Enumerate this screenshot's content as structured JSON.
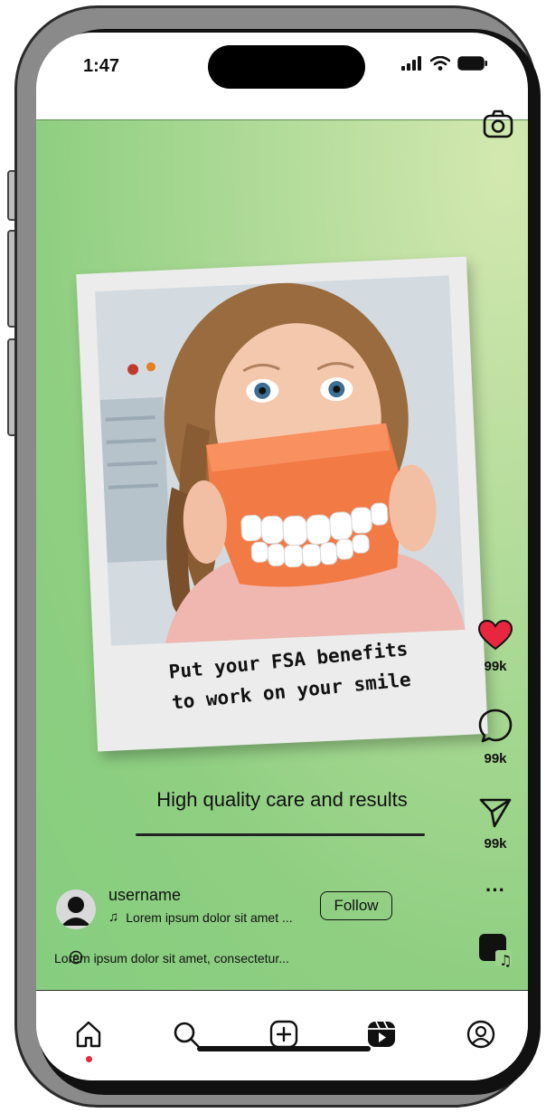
{
  "status_bar": {
    "time": "1:47"
  },
  "post": {
    "polaroid_caption_line1": "Put your FSA benefits",
    "polaroid_caption_line2": "to work on your smile",
    "tagline": "High quality care and results",
    "username": "username",
    "song": "Lorem ipsum dolor sit amet ...",
    "follow_label": "Follow",
    "description": "Lorem ipsum dolor sit amet, consectetur..."
  },
  "actions": {
    "likes": "99k",
    "comments": "99k",
    "shares": "99k",
    "more": "···"
  },
  "colors": {
    "like_red": "#e8263f",
    "gradient_light": "#d3e8b0",
    "gradient_dark": "#86cd7f",
    "notification_dot": "#e8263f"
  },
  "nav": {
    "items": [
      "home-icon",
      "search-icon",
      "create-icon",
      "reels-icon",
      "profile-icon"
    ]
  }
}
